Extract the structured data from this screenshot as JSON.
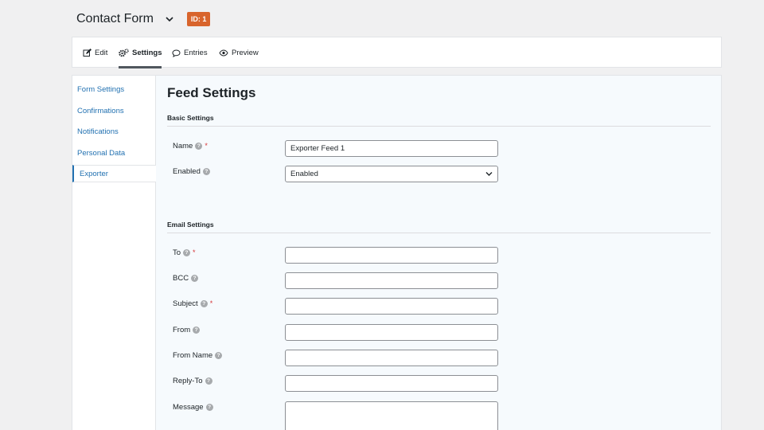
{
  "header": {
    "form_title": "Contact Form",
    "id_badge": "ID: 1",
    "chevron_icon": "chevron-down-icon"
  },
  "toolbar": {
    "tabs": [
      {
        "label": "Edit",
        "icon": "edit-icon"
      },
      {
        "label": "Settings",
        "icon": "gears-icon",
        "active": true
      },
      {
        "label": "Entries",
        "icon": "speech-bubble-icon"
      },
      {
        "label": "Preview",
        "icon": "eye-icon"
      }
    ]
  },
  "sidebar": {
    "items": [
      {
        "label": "Form Settings"
      },
      {
        "label": "Confirmations"
      },
      {
        "label": "Notifications"
      },
      {
        "label": "Personal Data"
      },
      {
        "label": "Exporter",
        "active": true
      }
    ]
  },
  "main": {
    "title": "Feed Settings",
    "basic_settings": {
      "section_title": "Basic Settings",
      "name_label": "Name",
      "name_value": "Exporter Feed 1",
      "enabled_label": "Enabled",
      "enabled_value": "Enabled"
    },
    "email_settings": {
      "section_title": "Email Settings",
      "to_label": "To",
      "bcc_label": "BCC",
      "subject_label": "Subject",
      "from_label": "From",
      "from_name_label": "From Name",
      "reply_to_label": "Reply-To",
      "message_label": "Message"
    },
    "help_glyph": "?",
    "required_glyph": "*"
  },
  "colors": {
    "accent": "#2271b1",
    "badge": "#d8642c",
    "required": "#d63638",
    "content_bg": "#f6fafd"
  }
}
